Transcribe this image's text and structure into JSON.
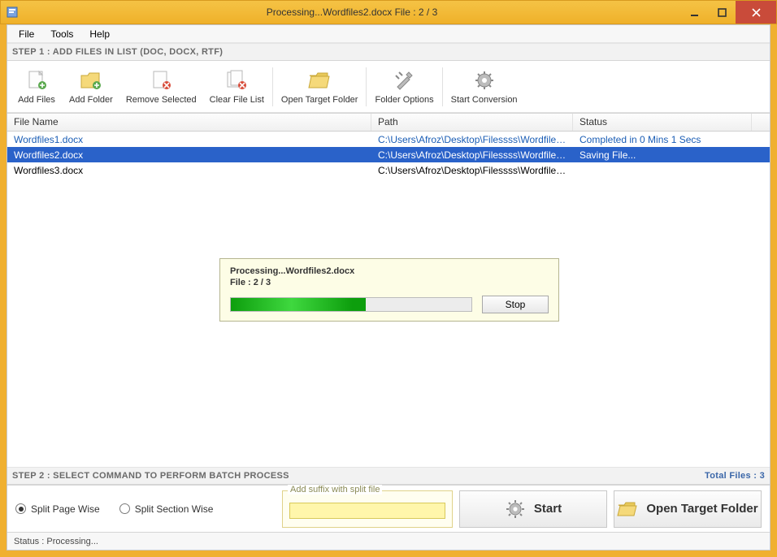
{
  "window": {
    "title": "Processing...Wordfiles2.docx File : 2 / 3"
  },
  "menubar": {
    "file": "File",
    "tools": "Tools",
    "help": "Help"
  },
  "step1": {
    "header": "STEP 1 : ADD FILES IN LIST (DOC, DOCX, RTF)"
  },
  "toolbar": {
    "add_files": "Add Files",
    "add_folder": "Add Folder",
    "remove_selected": "Remove Selected",
    "clear_list": "Clear File List",
    "open_target": "Open Target Folder",
    "folder_options": "Folder Options",
    "start_conversion": "Start Conversion"
  },
  "columns": {
    "name": "File Name",
    "path": "Path",
    "status": "Status"
  },
  "rows": [
    {
      "name": "Wordfiles1.docx",
      "path": "C:\\Users\\Afroz\\Desktop\\Filessss\\Wordfiles...",
      "status": "Completed in 0 Mins 1 Secs",
      "state": "link"
    },
    {
      "name": "Wordfiles2.docx",
      "path": "C:\\Users\\Afroz\\Desktop\\Filessss\\Wordfiles...",
      "status": "Saving File...",
      "state": "selected"
    },
    {
      "name": "Wordfiles3.docx",
      "path": "C:\\Users\\Afroz\\Desktop\\Filessss\\Wordfiles...",
      "status": "",
      "state": ""
    }
  ],
  "progress": {
    "line1": "Processing...Wordfiles2.docx",
    "line2": "File : 2 / 3",
    "percent": 56,
    "stop": "Stop"
  },
  "step2": {
    "header": "STEP 2 : SELECT COMMAND TO PERFORM BATCH PROCESS",
    "total_files": "Total Files : 3",
    "split_page": "Split Page Wise",
    "split_section": "Split Section Wise",
    "suffix_label": "Add suffix with split file",
    "suffix_value": "",
    "start": "Start",
    "open_target": "Open Target Folder"
  },
  "statusbar": {
    "text": "Status  :  Processing..."
  },
  "colors": {
    "accent": "#2a62c9",
    "chrome": "#efb12a"
  }
}
